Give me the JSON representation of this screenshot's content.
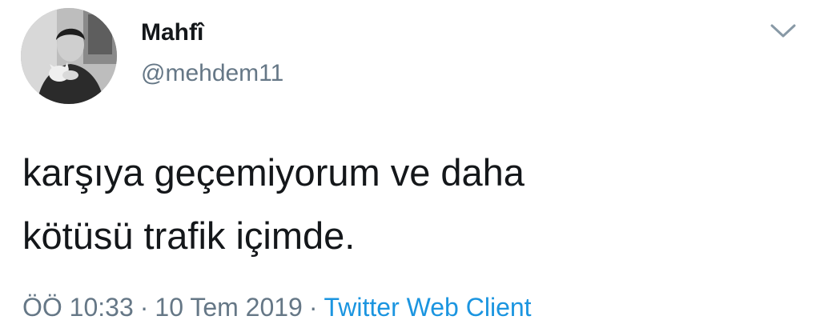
{
  "user": {
    "display_name": "Mahfî",
    "handle": "@mehdem11"
  },
  "tweet": {
    "text": "karşıya geçemiyorum ve daha\nkötüsü trafik içimde."
  },
  "meta": {
    "time": "ÖÖ 10:33",
    "separator": "·",
    "date": "10 Tem 2019",
    "source": "Twitter Web Client"
  },
  "icons": {
    "menu": "chevron-down-icon",
    "avatar": "profile-photo"
  },
  "colors": {
    "text": "#14171a",
    "secondary": "#657786",
    "link": "#1b95e0"
  }
}
